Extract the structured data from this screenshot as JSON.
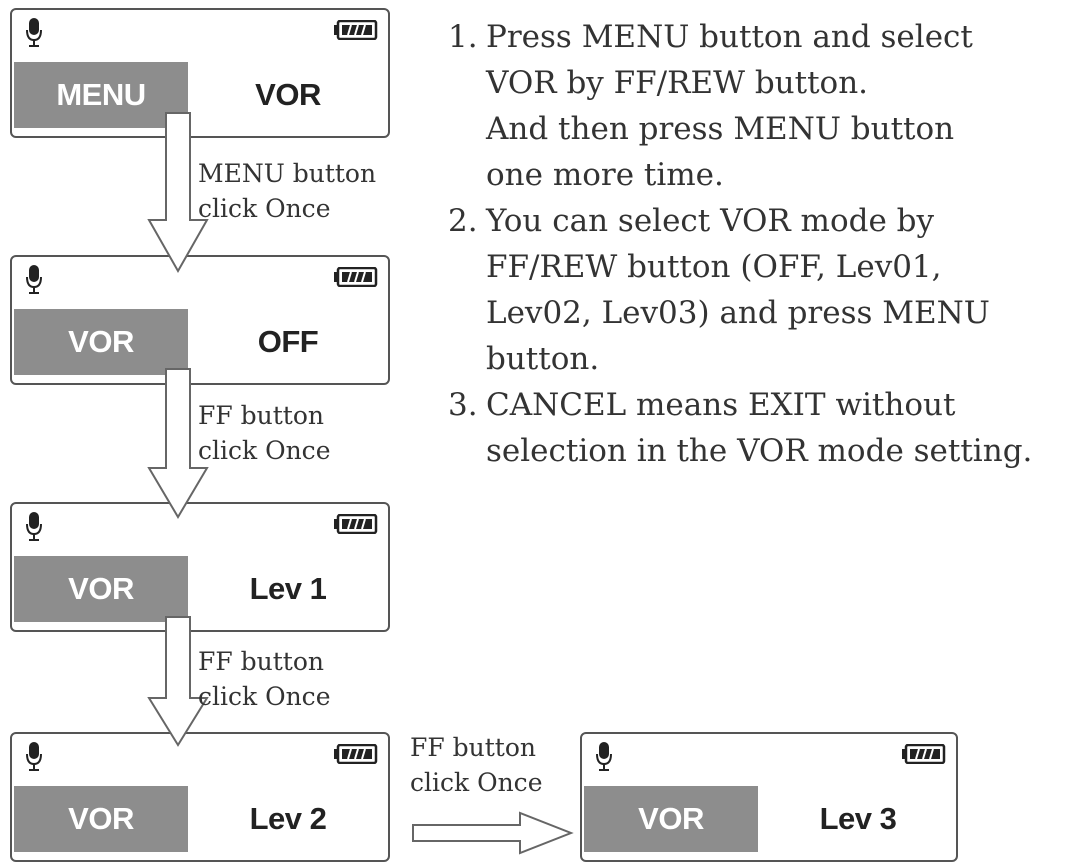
{
  "colors": {
    "label_fill": "#8d8d8d",
    "border": "#555555",
    "text": "#333333"
  },
  "icons": {
    "mic": "microphone-icon",
    "battery": "battery-icon"
  },
  "screens": [
    {
      "label": "MENU",
      "value": "VOR"
    },
    {
      "label": "VOR",
      "value": "OFF"
    },
    {
      "label": "VOR",
      "value": "Lev 1"
    },
    {
      "label": "VOR",
      "value": "Lev 2"
    },
    {
      "label": "VOR",
      "value": "Lev 3"
    }
  ],
  "steps": [
    {
      "line1": "MENU button",
      "line2": "click Once"
    },
    {
      "line1": "FF button",
      "line2": "click Once"
    },
    {
      "line1": "FF button",
      "line2": "click Once"
    },
    {
      "line1": "FF button",
      "line2": "click Once"
    }
  ],
  "instructions": [
    {
      "num": "1.",
      "lines": [
        "Press MENU button and select",
        "VOR by FF/REW button.",
        "And then press MENU button",
        "one more time."
      ]
    },
    {
      "num": "2.",
      "lines": [
        "You can select VOR mode by",
        "FF/REW button (OFF, Lev01,",
        "Lev02, Lev03) and press MENU",
        "button."
      ]
    },
    {
      "num": "3.",
      "lines": [
        "CANCEL means EXIT without",
        "selection in the VOR mode setting."
      ]
    }
  ]
}
